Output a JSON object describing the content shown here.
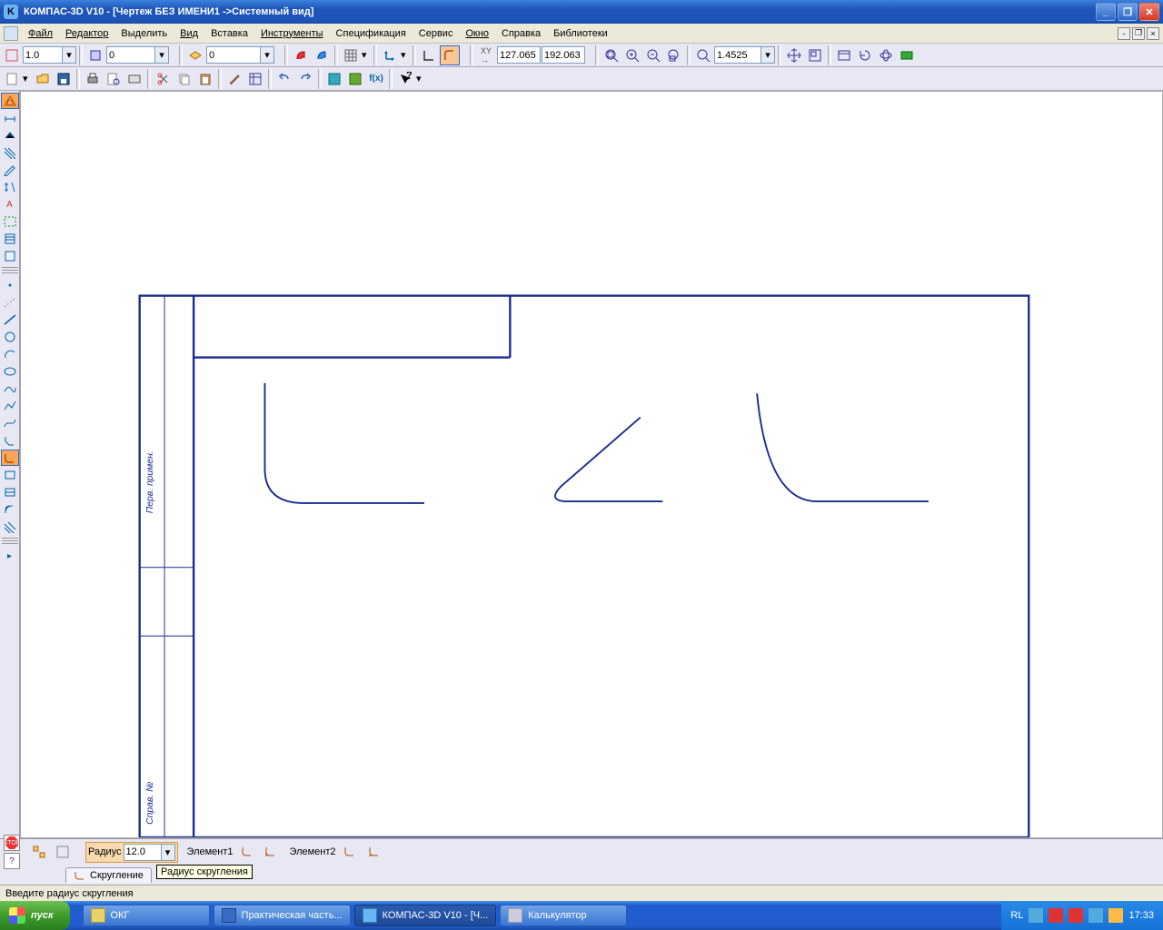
{
  "window": {
    "title": "КОМПАС-3D V10 - [Чертеж БЕЗ ИМЕНИ1 ->Системный вид]"
  },
  "menu": {
    "items": [
      "Файл",
      "Редактор",
      "Выделить",
      "Вид",
      "Вставка",
      "Инструменты",
      "Спецификация",
      "Сервис",
      "Окно",
      "Справка",
      "Библиотеки"
    ]
  },
  "toolbar1": {
    "step": "1.0",
    "state": "0",
    "layer": "0",
    "coord_x": "127.065",
    "coord_y": "192.063",
    "zoom": "1.4525"
  },
  "properties": {
    "radius_label": "Радиус",
    "radius_value": "12.0",
    "element1_label": "Элемент1",
    "element2_label": "Элемент2",
    "tab_label": "Скругление",
    "tooltip": "Радиус скругления"
  },
  "status": {
    "msg": "Введите радиус скругления"
  },
  "taskbar": {
    "start": "пуск",
    "tasks": [
      "ОКГ",
      "Практическая часть...",
      "КОМПАС-3D V10 - [Ч...",
      "Калькулятор"
    ],
    "lang": "RL",
    "clock": "17:33"
  },
  "sidebar_label1": "Перв. примен.",
  "sidebar_label2": "Справ. №"
}
